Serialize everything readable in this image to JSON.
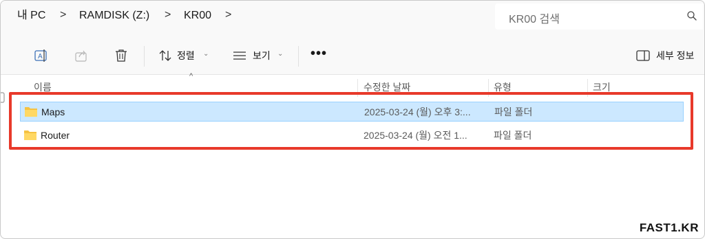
{
  "breadcrumb": {
    "items": [
      "내 PC",
      "RAMDISK (Z:)",
      "KR00"
    ],
    "separator": ">"
  },
  "search": {
    "placeholder": "KR00 검색",
    "icon": "search-icon"
  },
  "toolbar": {
    "icons": [
      "rename-icon",
      "share-icon",
      "delete-icon"
    ],
    "sort_label": "정렬",
    "view_label": "보기",
    "more_label": "•••",
    "details_label": "세부 정보"
  },
  "columns": {
    "name": "이름",
    "date": "수정한 날짜",
    "type": "유형",
    "size": "크기"
  },
  "files": [
    {
      "name": "Maps",
      "date": "2025-03-24 (월) 오후 3:...",
      "type": "파일 폴더",
      "selected": true
    },
    {
      "name": "Router",
      "date": "2025-03-24 (월) 오전 1...",
      "type": "파일 폴더",
      "selected": false
    }
  ],
  "colors": {
    "selection": "#cce8ff",
    "highlight": "#e8392a",
    "folder": "#f5c242"
  },
  "watermark": "FAST1.KR"
}
